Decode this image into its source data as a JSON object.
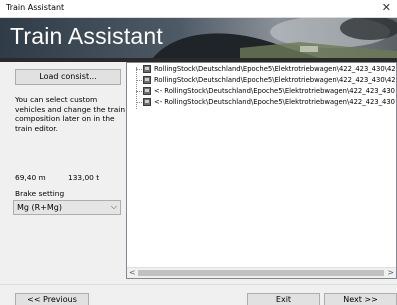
{
  "window": {
    "title": "Train Assistant",
    "close_glyph": "✕"
  },
  "banner": {
    "title": "Train Assistant"
  },
  "left_panel": {
    "load_button": "Load consist...",
    "description": "You can select custom vehicles and change the train composition later on in the train editor.",
    "length": "69,40 m",
    "weight": "133,00 t",
    "brake_label": "Brake setting",
    "brake_value": "Mg (R+Mg)",
    "brake_chevron": "⌵"
  },
  "consist_list": {
    "items": [
      "RollingStock\\Deutschland\\Epoche5\\Elektrotriebwagen\\422_423_430\\42",
      "RollingStock\\Deutschland\\Epoche5\\Elektrotriebwagen\\422_423_430\\42",
      "<- RollingStock\\Deutschland\\Epoche5\\Elektrotriebwagen\\422_423_430",
      "<- RollingStock\\Deutschland\\Epoche5\\Elektrotriebwagen\\422_423_430"
    ],
    "scroll_left": "<",
    "scroll_right": ">"
  },
  "footer": {
    "previous": "<< Previous",
    "exit": "Exit",
    "next": "Next >>"
  }
}
